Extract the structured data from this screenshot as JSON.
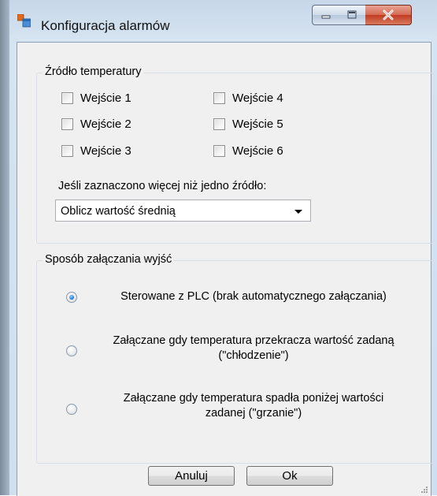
{
  "window": {
    "title": "Konfiguracja alarmów",
    "accent_color": "#2b7bd4"
  },
  "icons": {
    "app": "app-window-icon",
    "minimize": "minimize-icon",
    "maximize": "maximize-icon",
    "close": "close-icon"
  },
  "temperature_source": {
    "label": "Źródło temperatury",
    "inputs": [
      {
        "label": "Wejście 1",
        "checked": false
      },
      {
        "label": "Wejście 2",
        "checked": false
      },
      {
        "label": "Wejście 3",
        "checked": false
      },
      {
        "label": "Wejście 4",
        "checked": false
      },
      {
        "label": "Wejście 5",
        "checked": false
      },
      {
        "label": "Wejście 6",
        "checked": false
      }
    ],
    "multi_label": "Jeśli zaznaczono więcej niż jedno źródło:",
    "multi_value": "Oblicz wartość średnią"
  },
  "output_mode": {
    "label": "Sposób załączania wyjść",
    "options": [
      {
        "line1": "Sterowane z PLC (brak automatycznego załączania)",
        "line2": "",
        "selected": true
      },
      {
        "line1": "Załączane gdy temperatura przekracza wartość zadaną",
        "line2": "(\"chłodzenie\")",
        "selected": false
      },
      {
        "line1": "Załączane gdy temperatura spadła poniżej wartości",
        "line2": "zadanej (\"grzanie\")",
        "selected": false
      }
    ]
  },
  "buttons": {
    "cancel": "Anuluj",
    "ok": "Ok"
  }
}
